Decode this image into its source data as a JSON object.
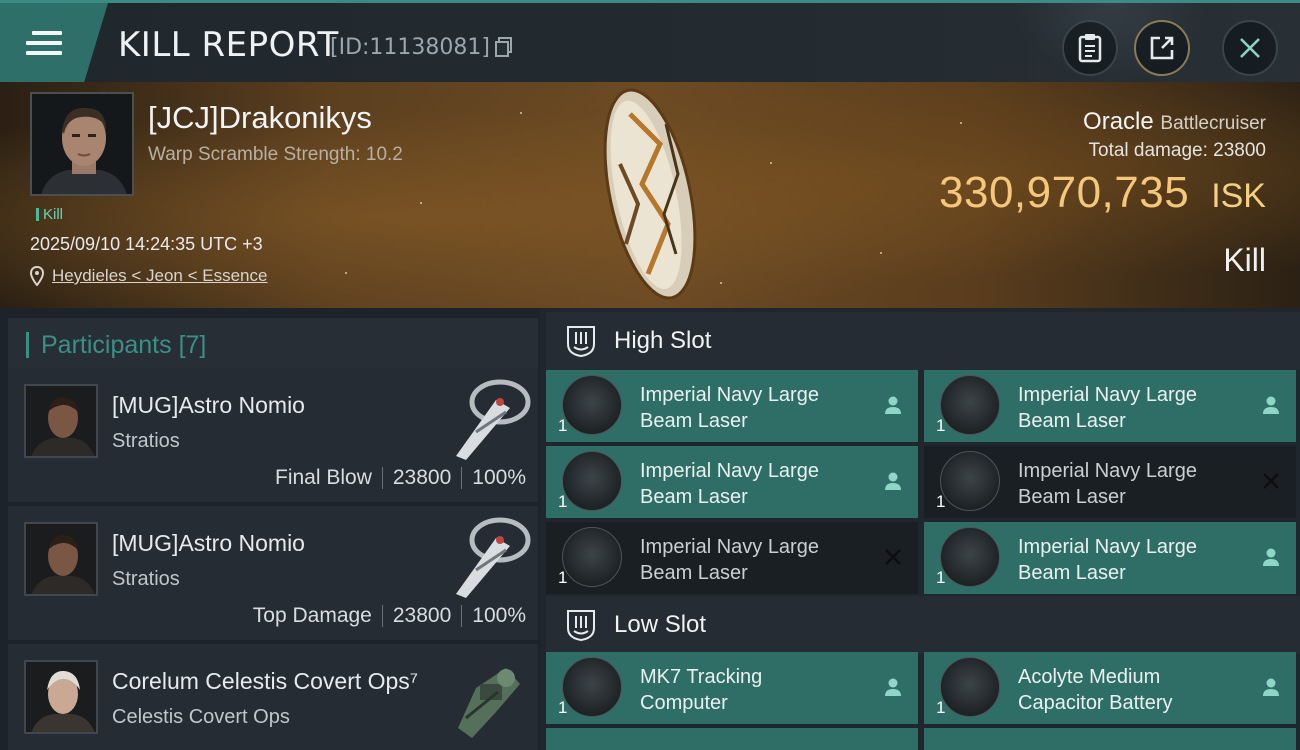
{
  "header": {
    "title": "KILL REPORT",
    "report_id": "[ID:11138081]"
  },
  "victim": {
    "name": "[JCJ]Drakonikys",
    "warp_scramble": "Warp Scramble Strength: 10.2",
    "tag": "Kill",
    "datetime": "2025/09/10 14:24:35 UTC +3",
    "location": "Heydieles < Jeon < Essence",
    "ship_name": "Oracle",
    "ship_class": "Battlecruiser",
    "total_damage_label": "Total damage:",
    "total_damage": "23800",
    "isk_value": "330,970,735",
    "isk_unit": "ISK",
    "result": "Kill"
  },
  "participants": {
    "label": "Participants",
    "count": "[7]",
    "items": [
      {
        "name": "[MUG]Astro Nomio",
        "ship": "Stratios",
        "role": "Final Blow",
        "damage": "23800",
        "percent": "100%"
      },
      {
        "name": "[MUG]Astro Nomio",
        "ship": "Stratios",
        "role": "Top Damage",
        "damage": "23800",
        "percent": "100%"
      },
      {
        "name": "Corelum Celestis Covert Ops⁷",
        "ship": "Celestis Covert Ops"
      }
    ]
  },
  "fitting": {
    "high_slot_label": "High Slot",
    "low_slot_label": "Low Slot",
    "high_slot": [
      {
        "name1": "Imperial Navy Large",
        "name2": "Beam Laser",
        "qty": "1",
        "state": "dropped"
      },
      {
        "name1": "Imperial Navy Large",
        "name2": "Beam Laser",
        "qty": "1",
        "state": "dropped"
      },
      {
        "name1": "Imperial Navy Large",
        "name2": "Beam Laser",
        "qty": "1",
        "state": "dropped"
      },
      {
        "name1": "Imperial Navy Large",
        "name2": "Beam Laser",
        "qty": "1",
        "state": "destroyed"
      },
      {
        "name1": "Imperial Navy Large",
        "name2": "Beam Laser",
        "qty": "1",
        "state": "destroyed"
      },
      {
        "name1": "Imperial Navy Large",
        "name2": "Beam Laser",
        "qty": "1",
        "state": "dropped"
      }
    ],
    "low_slot": [
      {
        "name1": "MK7 Tracking",
        "name2": "Computer",
        "qty": "1",
        "state": "dropped"
      },
      {
        "name1": "Acolyte Medium",
        "name2": "Capacitor Battery",
        "qty": "1",
        "state": "dropped"
      }
    ]
  },
  "colors": {
    "accent_teal": "#2f6e67",
    "isk_gold": "#f4c77a",
    "dark_module": "#1a1f24"
  },
  "icons": [
    "menu-icon",
    "copy-icon",
    "clipboard-icon",
    "share-icon",
    "close-icon",
    "location-pin-icon",
    "person-icon",
    "x-mark-icon",
    "slot-icon"
  ]
}
